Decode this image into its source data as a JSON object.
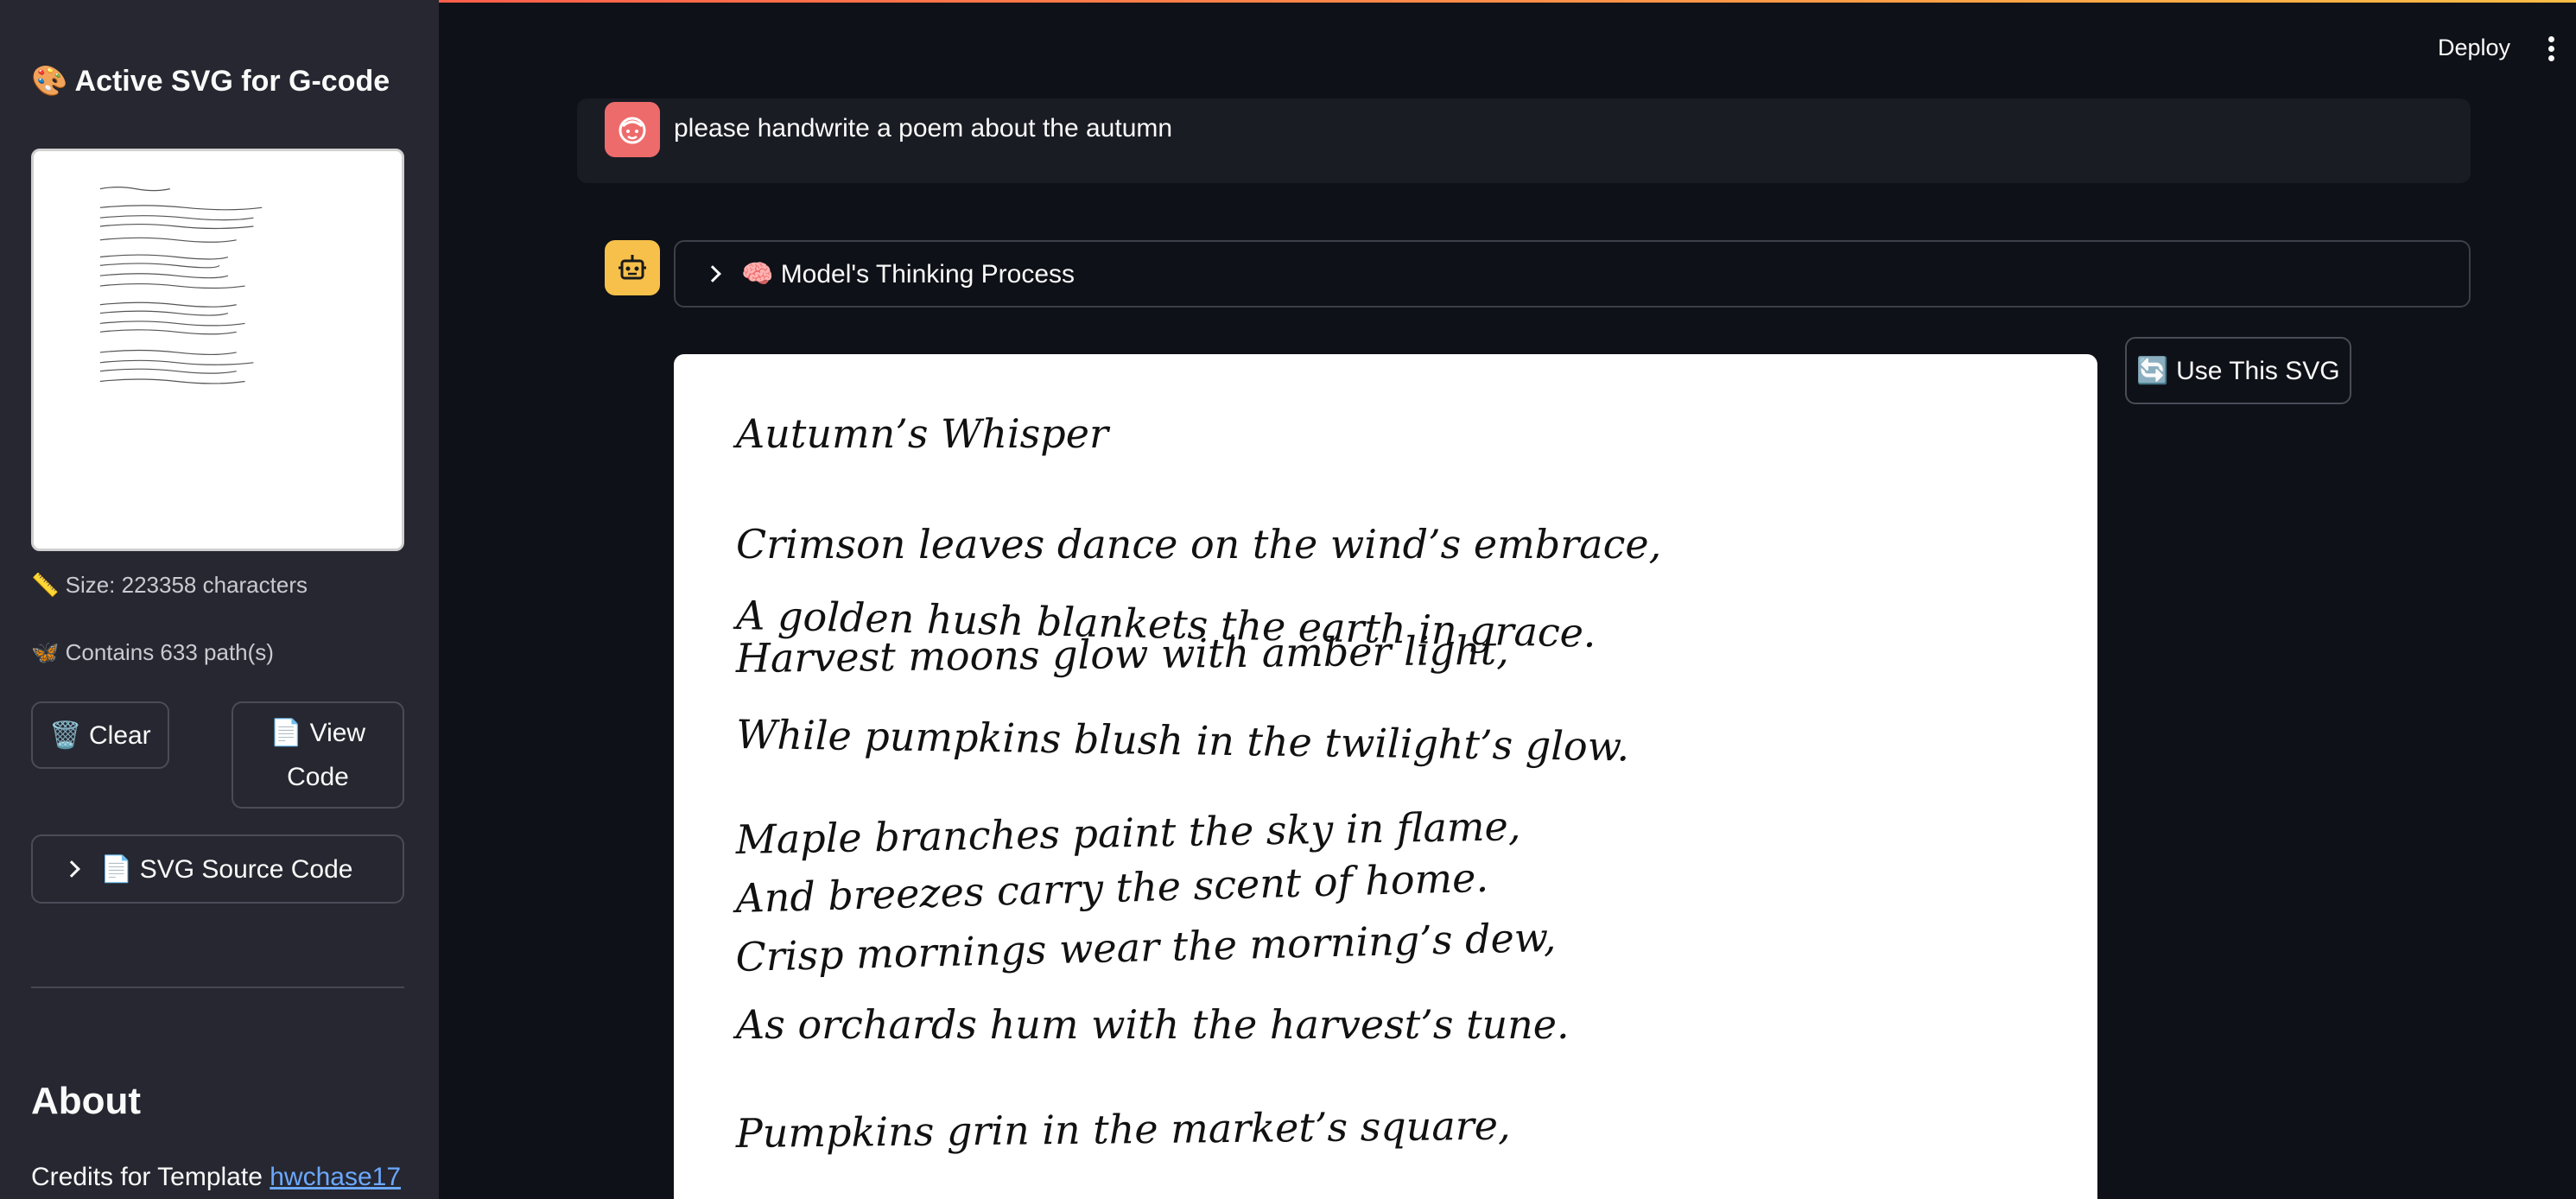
{
  "header": {
    "deploy_label": "Deploy"
  },
  "sidebar": {
    "title": "🎨 Active SVG for G-code",
    "size_text": "📏 Size: 223358 characters",
    "paths_text": "🦋 Contains 633 path(s)",
    "clear_label": "🗑️ Clear",
    "view_code_line1": "📄 View",
    "view_code_line2": "Code",
    "svg_source_label": "📄 SVG Source Code",
    "about_heading": "About",
    "credits_prefix": "Credits for Template ",
    "credits_link": "hwchase17"
  },
  "chat": {
    "user_message": "please handwrite a poem about the autumn",
    "thinking_label": "🧠 Model's Thinking Process",
    "use_svg_label": "🔄 Use This SVG"
  },
  "poem": {
    "lines": [
      "Autumn’s Whisper",
      "Crimson leaves dance on the wind’s embrace,",
      "A golden hush blankets the earth in grace.",
      "Harvest moons glow with amber light,",
      "While pumpkins blush in the twilight’s glow.",
      "Maple branches paint the sky in flame,",
      "And breezes carry the scent of home.",
      "Crisp mornings wear the morning’s dew,",
      "As orchards hum with the harvest’s tune.",
      "Pumpkins grin in the market’s square,"
    ]
  },
  "colors": {
    "user_avatar": "#ee6b6b",
    "bot_avatar": "#f6c04a",
    "link": "#6ba8ff"
  }
}
